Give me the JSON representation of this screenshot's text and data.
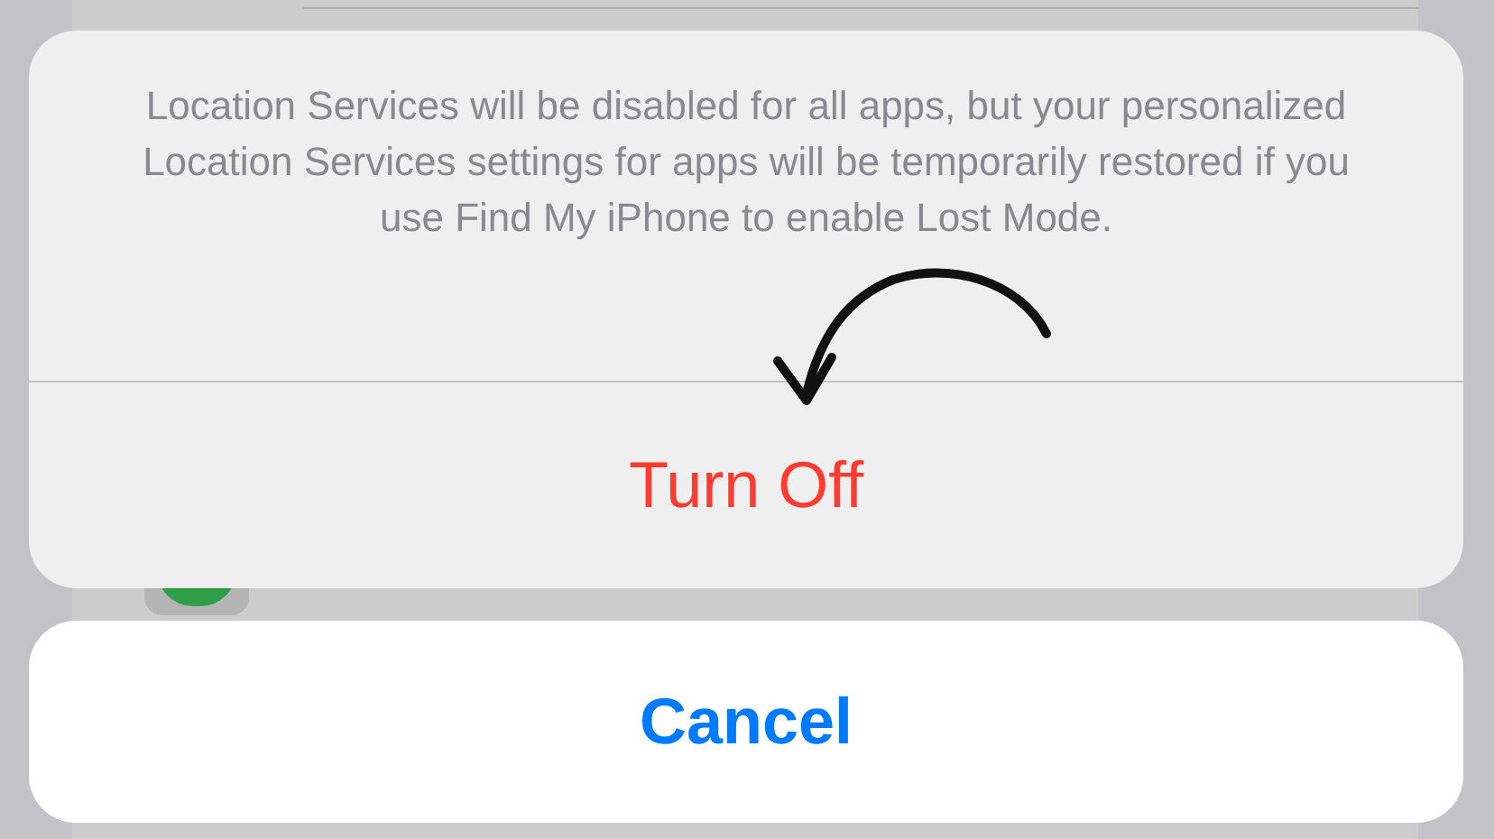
{
  "action_sheet": {
    "message": "Location Services will be disabled for all apps, but your personalized Location Services settings for apps will be temporarily restored if you use Find My iPhone to enable Lost Mode.",
    "actions": [
      {
        "label": "Turn Off",
        "kind": "destructive"
      }
    ]
  },
  "cancel_button": {
    "label": "Cancel"
  }
}
